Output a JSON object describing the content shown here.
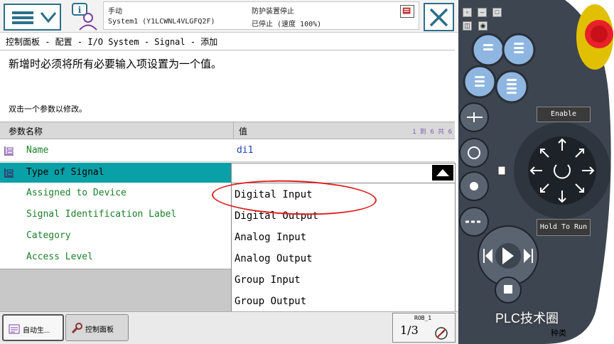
{
  "topbar": {
    "mode": "手动",
    "system": "System1 (Y1LCWNL4VLGFQ2F)",
    "guard_stop": "防护装置停止",
    "state": "已停止 (速度 100%)"
  },
  "breadcrumb": "控制面板 - 配置 - I/O System - Signal - 添加",
  "instruction": "新增时必须将所有必要输入项设置为一个值。",
  "hint": "双击一个参数以修改。",
  "table": {
    "col_name": "参数名称",
    "col_value": "值",
    "page_info": "1 到 6 共 6",
    "rows": [
      {
        "name": "Name",
        "value": "di1"
      },
      {
        "name": "Type of Signal",
        "value": ""
      },
      {
        "name": "Assigned to Device",
        "value": ""
      },
      {
        "name": "Signal Identification Label",
        "value": ""
      },
      {
        "name": "Category",
        "value": ""
      },
      {
        "name": "Access Level",
        "value": ""
      }
    ]
  },
  "dropdown": {
    "options": [
      "Digital Input",
      "Digital Output",
      "Analog Input",
      "Analog Output",
      "Group Input",
      "Group Output"
    ]
  },
  "taskbar": {
    "task1": "自动生...",
    "task2": "控制面板",
    "robot": "ROB_1",
    "fraction": "1/3"
  },
  "pendant": {
    "enable_label": "Enable",
    "hold_label": "Hold To Run",
    "watermark": "PLC技术圈",
    "bottom_text": "种类"
  },
  "colors": {
    "accent": "#2b6f8a",
    "selected_row": "#0aa0a8",
    "param_name": "#1a7f2a",
    "param_value": "#1a3fb5",
    "annotation": "#e02020",
    "estop": "#e8202a",
    "pendant_body": "#3c4550"
  }
}
